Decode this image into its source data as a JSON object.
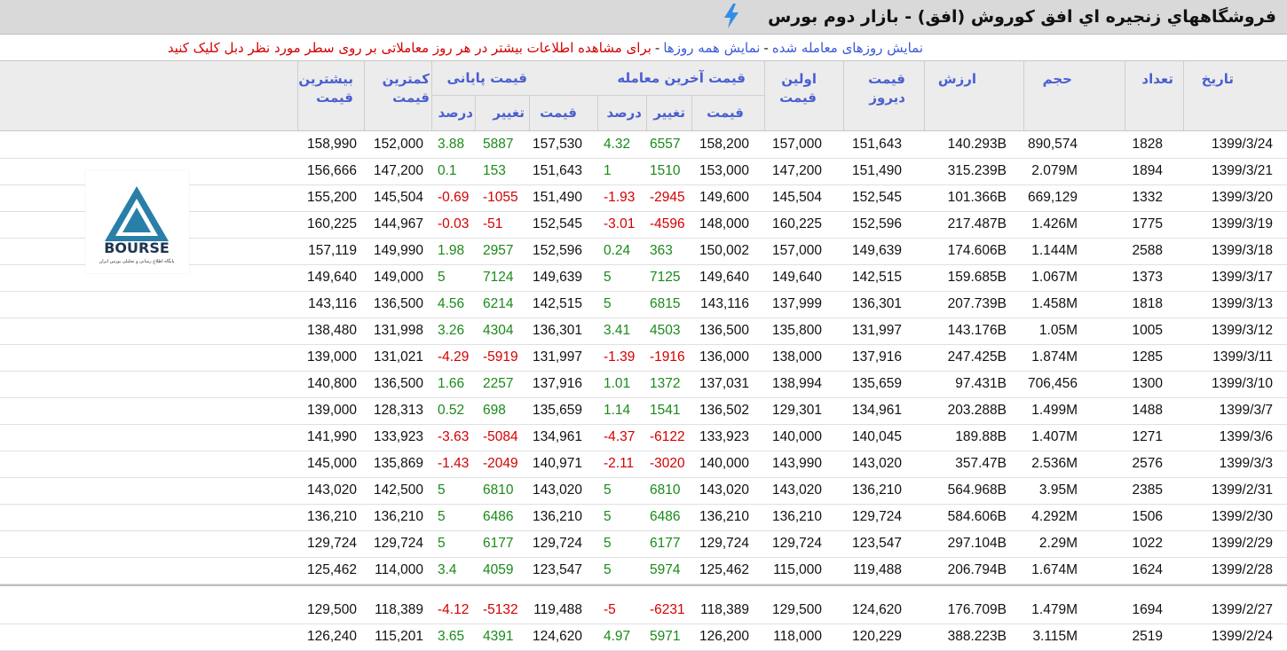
{
  "title": "فروشگاههاي زنجيره اي افق كوروش (افق) - بازار دوم بورس",
  "subline": {
    "link_traded": "نمایش روزهای معامله شده",
    "link_all": "نمایش همه روزها",
    "note": "برای مشاهده اطلاعات بیشتر در هر روز معاملاتی بر روی سطر مورد نظر دبل کلیک کنید"
  },
  "headers": {
    "date": "تاریخ",
    "count": "تعداد",
    "volume": "حجم",
    "value": "ارزش",
    "yesterday": "قیمت دیروز",
    "first": "اولین قیمت",
    "last_group": "قیمت آخرین معامله",
    "close_group": "قیمت پایانی",
    "price": "قیمت",
    "change": "تغییر",
    "percent": "درصد",
    "min": "کمترین قیمت",
    "max": "بیشترین قیمت"
  },
  "logo": {
    "text": "BOURSE",
    "subtitle": "پایگاه اطلاع رسانی و تحلیلی بورس ایران",
    "brand_color": "#2a7fa8"
  },
  "colors": {
    "positive": "#1a8a1a",
    "negative": "#d40000",
    "header_text": "#4a5fd0"
  },
  "rows": [
    {
      "date": "1399/3/24",
      "count": "1828",
      "volume": "890,574",
      "value": "140.293B",
      "yesterday": "151,643",
      "first": "157,000",
      "last_price": "158,200",
      "last_change": "6557",
      "last_pct": "4.32",
      "close_price": "157,530",
      "close_change": "5887",
      "close_pct": "3.88",
      "min": "152,000",
      "max": "158,990"
    },
    {
      "date": "1399/3/21",
      "count": "1894",
      "volume": "2.079M",
      "value": "315.239B",
      "yesterday": "151,490",
      "first": "147,200",
      "last_price": "153,000",
      "last_change": "1510",
      "last_pct": "1",
      "close_price": "151,643",
      "close_change": "153",
      "close_pct": "0.1",
      "min": "147,200",
      "max": "156,666"
    },
    {
      "date": "1399/3/20",
      "count": "1332",
      "volume": "669,129",
      "value": "101.366B",
      "yesterday": "152,545",
      "first": "145,504",
      "last_price": "149,600",
      "last_change": "-2945",
      "last_pct": "-1.93",
      "close_price": "151,490",
      "close_change": "-1055",
      "close_pct": "-0.69",
      "min": "145,504",
      "max": "155,200"
    },
    {
      "date": "1399/3/19",
      "count": "1775",
      "volume": "1.426M",
      "value": "217.487B",
      "yesterday": "152,596",
      "first": "160,225",
      "last_price": "148,000",
      "last_change": "-4596",
      "last_pct": "-3.01",
      "close_price": "152,545",
      "close_change": "-51",
      "close_pct": "-0.03",
      "min": "144,967",
      "max": "160,225"
    },
    {
      "date": "1399/3/18",
      "count": "2588",
      "volume": "1.144M",
      "value": "174.606B",
      "yesterday": "149,639",
      "first": "157,000",
      "last_price": "150,002",
      "last_change": "363",
      "last_pct": "0.24",
      "close_price": "152,596",
      "close_change": "2957",
      "close_pct": "1.98",
      "min": "149,990",
      "max": "157,119"
    },
    {
      "date": "1399/3/17",
      "count": "1373",
      "volume": "1.067M",
      "value": "159.685B",
      "yesterday": "142,515",
      "first": "149,640",
      "last_price": "149,640",
      "last_change": "7125",
      "last_pct": "5",
      "close_price": "149,639",
      "close_change": "7124",
      "close_pct": "5",
      "min": "149,000",
      "max": "149,640"
    },
    {
      "date": "1399/3/13",
      "count": "1818",
      "volume": "1.458M",
      "value": "207.739B",
      "yesterday": "136,301",
      "first": "137,999",
      "last_price": "143,116",
      "last_change": "6815",
      "last_pct": "5",
      "close_price": "142,515",
      "close_change": "6214",
      "close_pct": "4.56",
      "min": "136,500",
      "max": "143,116"
    },
    {
      "date": "1399/3/12",
      "count": "1005",
      "volume": "1.05M",
      "value": "143.176B",
      "yesterday": "131,997",
      "first": "135,800",
      "last_price": "136,500",
      "last_change": "4503",
      "last_pct": "3.41",
      "close_price": "136,301",
      "close_change": "4304",
      "close_pct": "3.26",
      "min": "131,998",
      "max": "138,480"
    },
    {
      "date": "1399/3/11",
      "count": "1285",
      "volume": "1.874M",
      "value": "247.425B",
      "yesterday": "137,916",
      "first": "138,000",
      "last_price": "136,000",
      "last_change": "-1916",
      "last_pct": "-1.39",
      "close_price": "131,997",
      "close_change": "-5919",
      "close_pct": "-4.29",
      "min": "131,021",
      "max": "139,000"
    },
    {
      "date": "1399/3/10",
      "count": "1300",
      "volume": "706,456",
      "value": "97.431B",
      "yesterday": "135,659",
      "first": "138,994",
      "last_price": "137,031",
      "last_change": "1372",
      "last_pct": "1.01",
      "close_price": "137,916",
      "close_change": "2257",
      "close_pct": "1.66",
      "min": "136,500",
      "max": "140,800"
    },
    {
      "date": "1399/3/7",
      "count": "1488",
      "volume": "1.499M",
      "value": "203.288B",
      "yesterday": "134,961",
      "first": "129,301",
      "last_price": "136,502",
      "last_change": "1541",
      "last_pct": "1.14",
      "close_price": "135,659",
      "close_change": "698",
      "close_pct": "0.52",
      "min": "128,313",
      "max": "139,000"
    },
    {
      "date": "1399/3/6",
      "count": "1271",
      "volume": "1.407M",
      "value": "189.88B",
      "yesterday": "140,045",
      "first": "140,000",
      "last_price": "133,923",
      "last_change": "-6122",
      "last_pct": "-4.37",
      "close_price": "134,961",
      "close_change": "-5084",
      "close_pct": "-3.63",
      "min": "133,923",
      "max": "141,990"
    },
    {
      "date": "1399/3/3",
      "count": "2576",
      "volume": "2.536M",
      "value": "357.47B",
      "yesterday": "143,020",
      "first": "143,990",
      "last_price": "140,000",
      "last_change": "-3020",
      "last_pct": "-2.11",
      "close_price": "140,971",
      "close_change": "-2049",
      "close_pct": "-1.43",
      "min": "135,869",
      "max": "145,000"
    },
    {
      "date": "1399/2/31",
      "count": "2385",
      "volume": "3.95M",
      "value": "564.968B",
      "yesterday": "136,210",
      "first": "143,020",
      "last_price": "143,020",
      "last_change": "6810",
      "last_pct": "5",
      "close_price": "143,020",
      "close_change": "6810",
      "close_pct": "5",
      "min": "142,500",
      "max": "143,020"
    },
    {
      "date": "1399/2/30",
      "count": "1506",
      "volume": "4.292M",
      "value": "584.606B",
      "yesterday": "129,724",
      "first": "136,210",
      "last_price": "136,210",
      "last_change": "6486",
      "last_pct": "5",
      "close_price": "136,210",
      "close_change": "6486",
      "close_pct": "5",
      "min": "136,210",
      "max": "136,210"
    },
    {
      "date": "1399/2/29",
      "count": "1022",
      "volume": "2.29M",
      "value": "297.104B",
      "yesterday": "123,547",
      "first": "129,724",
      "last_price": "129,724",
      "last_change": "6177",
      "last_pct": "5",
      "close_price": "129,724",
      "close_change": "6177",
      "close_pct": "5",
      "min": "129,724",
      "max": "129,724"
    },
    {
      "date": "1399/2/28",
      "count": "1624",
      "volume": "1.674M",
      "value": "206.794B",
      "yesterday": "119,488",
      "first": "115,000",
      "last_price": "125,462",
      "last_change": "5974",
      "last_pct": "5",
      "close_price": "123,547",
      "close_change": "4059",
      "close_pct": "3.4",
      "min": "114,000",
      "max": "125,462"
    },
    {
      "date": "1399/2/27",
      "count": "1694",
      "volume": "1.479M",
      "value": "176.709B",
      "yesterday": "124,620",
      "first": "129,500",
      "last_price": "118,389",
      "last_change": "-6231",
      "last_pct": "-5",
      "close_price": "119,488",
      "close_change": "-5132",
      "close_pct": "-4.12",
      "min": "118,389",
      "max": "129,500"
    },
    {
      "date": "1399/2/24",
      "count": "2519",
      "volume": "3.115M",
      "value": "388.223B",
      "yesterday": "120,229",
      "first": "118,000",
      "last_price": "126,200",
      "last_change": "5971",
      "last_pct": "4.97",
      "close_price": "124,620",
      "close_change": "4391",
      "close_pct": "3.65",
      "min": "115,201",
      "max": "126,240"
    }
  ]
}
